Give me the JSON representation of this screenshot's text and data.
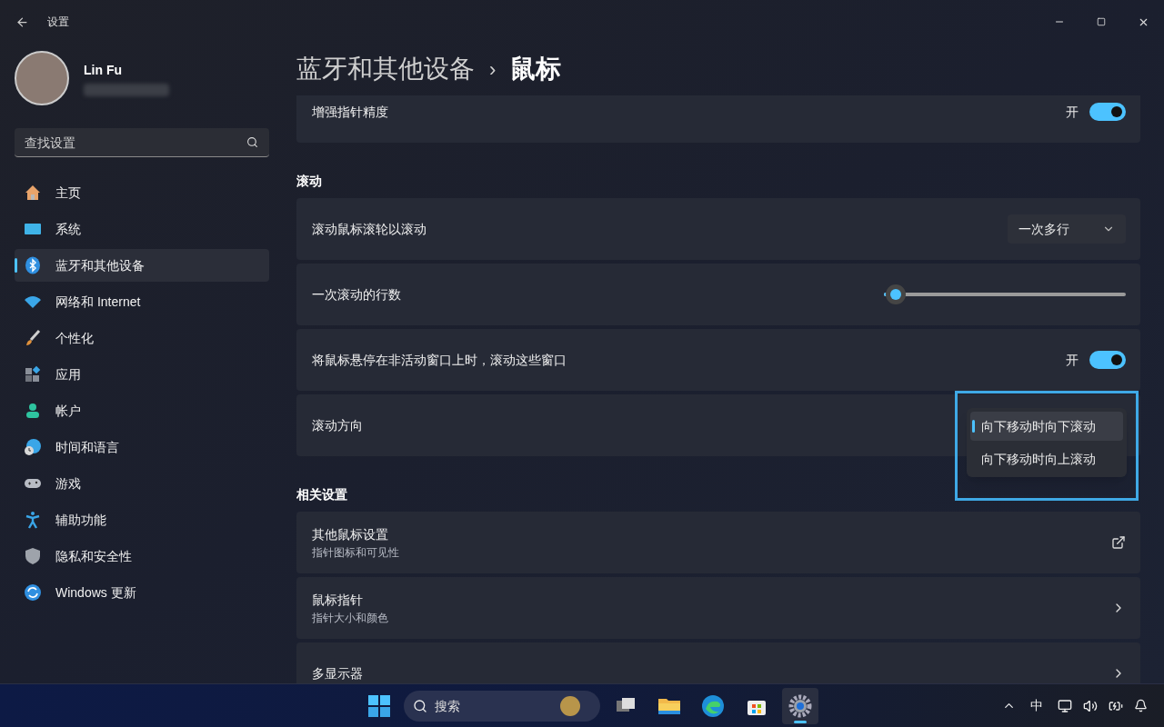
{
  "window": {
    "title": "设置"
  },
  "user": {
    "name": "Lin Fu"
  },
  "search": {
    "placeholder": "查找设置"
  },
  "nav": [
    {
      "label": "主页",
      "selected": false
    },
    {
      "label": "系统",
      "selected": false
    },
    {
      "label": "蓝牙和其他设备",
      "selected": true
    },
    {
      "label": "网络和 Internet",
      "selected": false
    },
    {
      "label": "个性化",
      "selected": false
    },
    {
      "label": "应用",
      "selected": false
    },
    {
      "label": "帐户",
      "selected": false
    },
    {
      "label": "时间和语言",
      "selected": false
    },
    {
      "label": "游戏",
      "selected": false
    },
    {
      "label": "辅助功能",
      "selected": false
    },
    {
      "label": "隐私和安全性",
      "selected": false
    },
    {
      "label": "Windows 更新",
      "selected": false
    }
  ],
  "breadcrumb": {
    "parent": "蓝牙和其他设备",
    "separator": "›",
    "current": "鼠标"
  },
  "sections": [
    {
      "items": [
        {
          "kind": "toggle",
          "label": "增强指针精度",
          "state_text": "开",
          "on": true
        }
      ]
    },
    {
      "heading": "滚动",
      "items": [
        {
          "kind": "dropdown",
          "label": "滚动鼠标滚轮以滚动",
          "value": "一次多行"
        },
        {
          "kind": "slider",
          "label": "一次滚动的行数",
          "level": 0.05
        },
        {
          "kind": "toggle",
          "label": "将鼠标悬停在非活动窗口上时，滚动这些窗口",
          "state_text": "开",
          "on": true
        },
        {
          "kind": "menu",
          "label": "滚动方向",
          "options": [
            {
              "label": "向下移动时向下滚动",
              "selected": true
            },
            {
              "label": "向下移动时向上滚动",
              "selected": false
            }
          ]
        }
      ]
    },
    {
      "heading": "相关设置",
      "items": [
        {
          "kind": "external",
          "label": "其他鼠标设置",
          "description": "指针图标和可见性"
        },
        {
          "kind": "nav",
          "label": "鼠标指针",
          "description": "指针大小和颜色"
        },
        {
          "kind": "nav",
          "label": "多显示器"
        }
      ]
    }
  ],
  "taskbar": {
    "search_placeholder": "搜索",
    "ime": "中",
    "apps": [
      {
        "selected": false
      },
      {
        "selected": false
      },
      {
        "selected": false
      },
      {
        "selected": false
      },
      {
        "selected": true
      }
    ]
  }
}
